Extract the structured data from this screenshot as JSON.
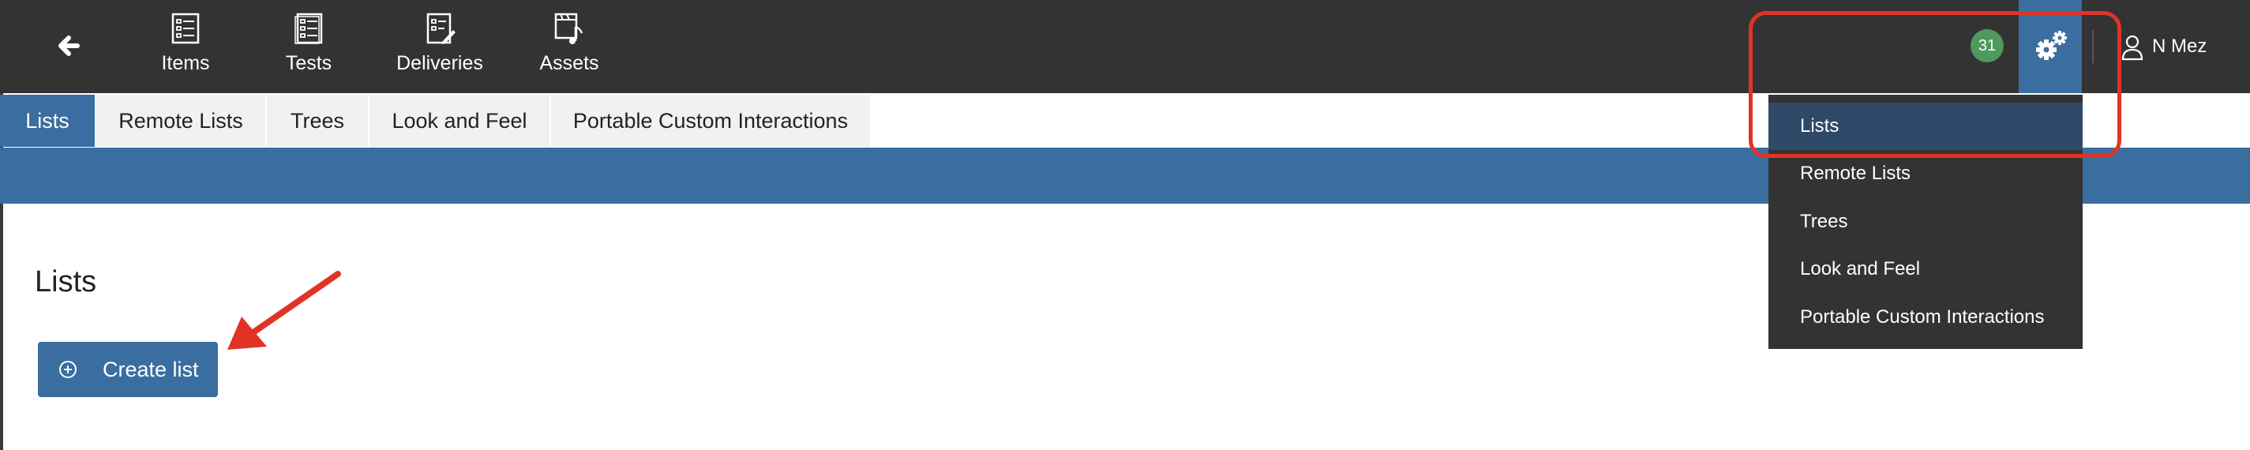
{
  "topbar": {
    "nav": [
      {
        "label": "Items",
        "icon": "items-icon"
      },
      {
        "label": "Tests",
        "icon": "tests-icon"
      },
      {
        "label": "Deliveries",
        "icon": "deliveries-icon"
      },
      {
        "label": "Assets",
        "icon": "assets-icon"
      }
    ],
    "notification_count": "31",
    "user_name": "N Mez"
  },
  "tabs": [
    {
      "label": "Lists",
      "active": true
    },
    {
      "label": "Remote Lists",
      "active": false
    },
    {
      "label": "Trees",
      "active": false
    },
    {
      "label": "Look and Feel",
      "active": false
    },
    {
      "label": "Portable Custom Interactions",
      "active": false
    }
  ],
  "main": {
    "title": "Lists",
    "create_label": "Create list"
  },
  "settings_menu": {
    "items": [
      {
        "label": "Lists",
        "selected": true
      },
      {
        "label": "Remote Lists",
        "selected": false
      },
      {
        "label": "Trees",
        "selected": false
      },
      {
        "label": "Look and Feel",
        "selected": false
      },
      {
        "label": "Portable Custom Interactions",
        "selected": false
      }
    ]
  },
  "colors": {
    "topbar": "#333333",
    "accent": "#3a6ea0",
    "badge": "#4e9a5d",
    "annotation": "#e03326"
  }
}
